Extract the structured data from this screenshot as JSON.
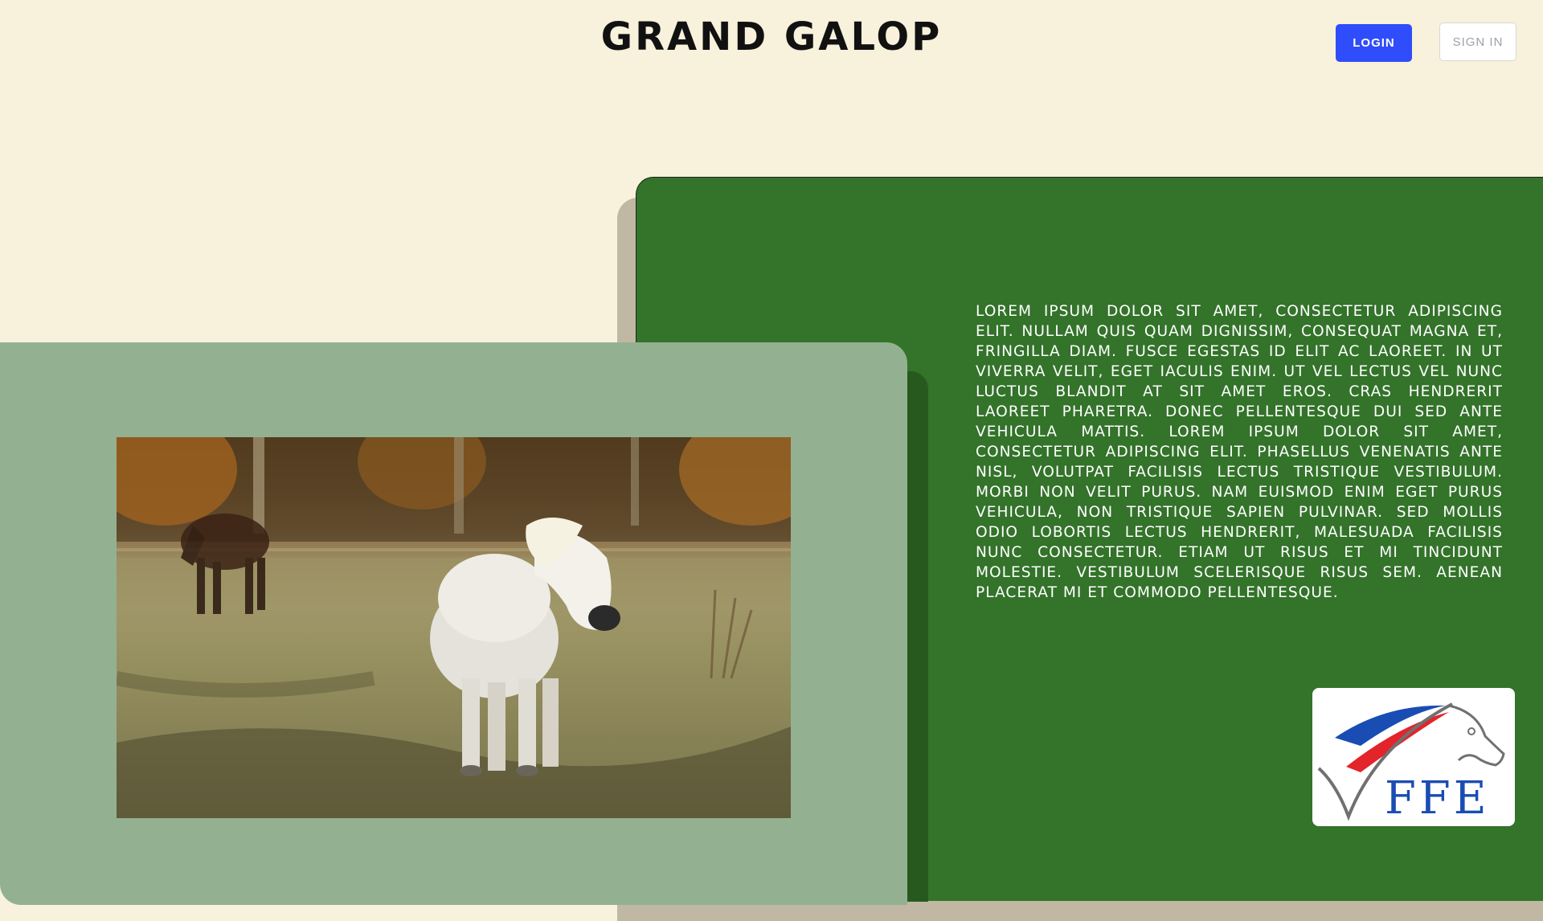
{
  "header": {
    "title": "GRAND GALOP",
    "login_label": "LOGIN",
    "signin_label": "SIGN IN"
  },
  "main": {
    "description": "Lorem ipsum dolor sit amet, consectetur adipiscing elit. Nullam quis quam dignissim, consequat magna et, fringilla diam. Fusce egestas id elit ac laoreet. In ut viverra velit, eget iaculis enim. Ut vel lectus vel nunc luctus blandit at sit amet eros. Cras hendrerit laoreet pharetra. Donec pellentesque dui sed ante vehicula mattis. Lorem ipsum dolor sit amet, consectetur adipiscing elit. Phasellus venenatis ante nisl, volutpat facilisis lectus tristique vestibulum. Morbi non velit purus. Nam euismod enim eget purus vehicula, non tristique sapien pulvinar. Sed mollis odio lobortis lectus hendrerit, malesuada facilisis nunc consectetur. Etiam ut risus et mi tincidunt molestie. Vestibulum scelerisque risus sem. Aenean placerat mi et commodo pellentesque.",
    "photo_subject": "white-pony-in-pasture",
    "logo": {
      "text": "FFE"
    }
  },
  "colors": {
    "background": "#f8f1db",
    "primary_button": "#2f4dfb",
    "green_panel": "#33732a",
    "sage_card": "#93b191"
  }
}
